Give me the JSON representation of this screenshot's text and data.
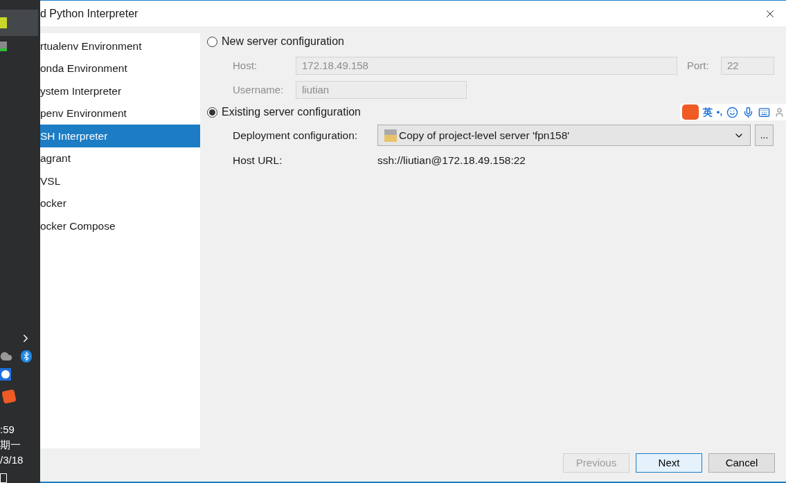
{
  "taskbar": {
    "clock": [
      ":59",
      "期一",
      "/3/18"
    ]
  },
  "window": {
    "title": "d Python Interpreter"
  },
  "sidebar": {
    "items": [
      {
        "label": "rtualenv Environment",
        "selected": false
      },
      {
        "label": "onda Environment",
        "selected": false
      },
      {
        "label": "ystem Interpreter",
        "selected": false
      },
      {
        "label": "penv Environment",
        "selected": false
      },
      {
        "label": "SH Interpreter",
        "selected": true
      },
      {
        "label": "agrant",
        "selected": false
      },
      {
        "label": "VSL",
        "selected": false
      },
      {
        "label": "ocker",
        "selected": false
      },
      {
        "label": "ocker Compose",
        "selected": false
      }
    ]
  },
  "options": [
    {
      "label": "New server configuration",
      "selected": false
    },
    {
      "label": "Existing server configuration",
      "selected": true
    }
  ],
  "new_server": {
    "host_label": "Host:",
    "host": "172.18.49.158",
    "port_label": "Port:",
    "port": "22",
    "username_label": "Username:",
    "username": "liutian",
    "disabled": true
  },
  "existing_server": {
    "deployment_label": "Deployment configuration:",
    "deployment": "Copy of project-level server 'fpn158'",
    "browse": "...",
    "host_url_label": "Host URL:",
    "host_url": "ssh://liutian@172.18.49.158:22"
  },
  "ime_toolbar": {
    "mode": "英",
    "punct": "•,"
  },
  "buttons": [
    {
      "label": "Previous",
      "disabled": true,
      "default": false
    },
    {
      "label": "Next",
      "disabled": false,
      "default": true
    },
    {
      "label": "Cancel",
      "disabled": false,
      "default": false
    }
  ]
}
